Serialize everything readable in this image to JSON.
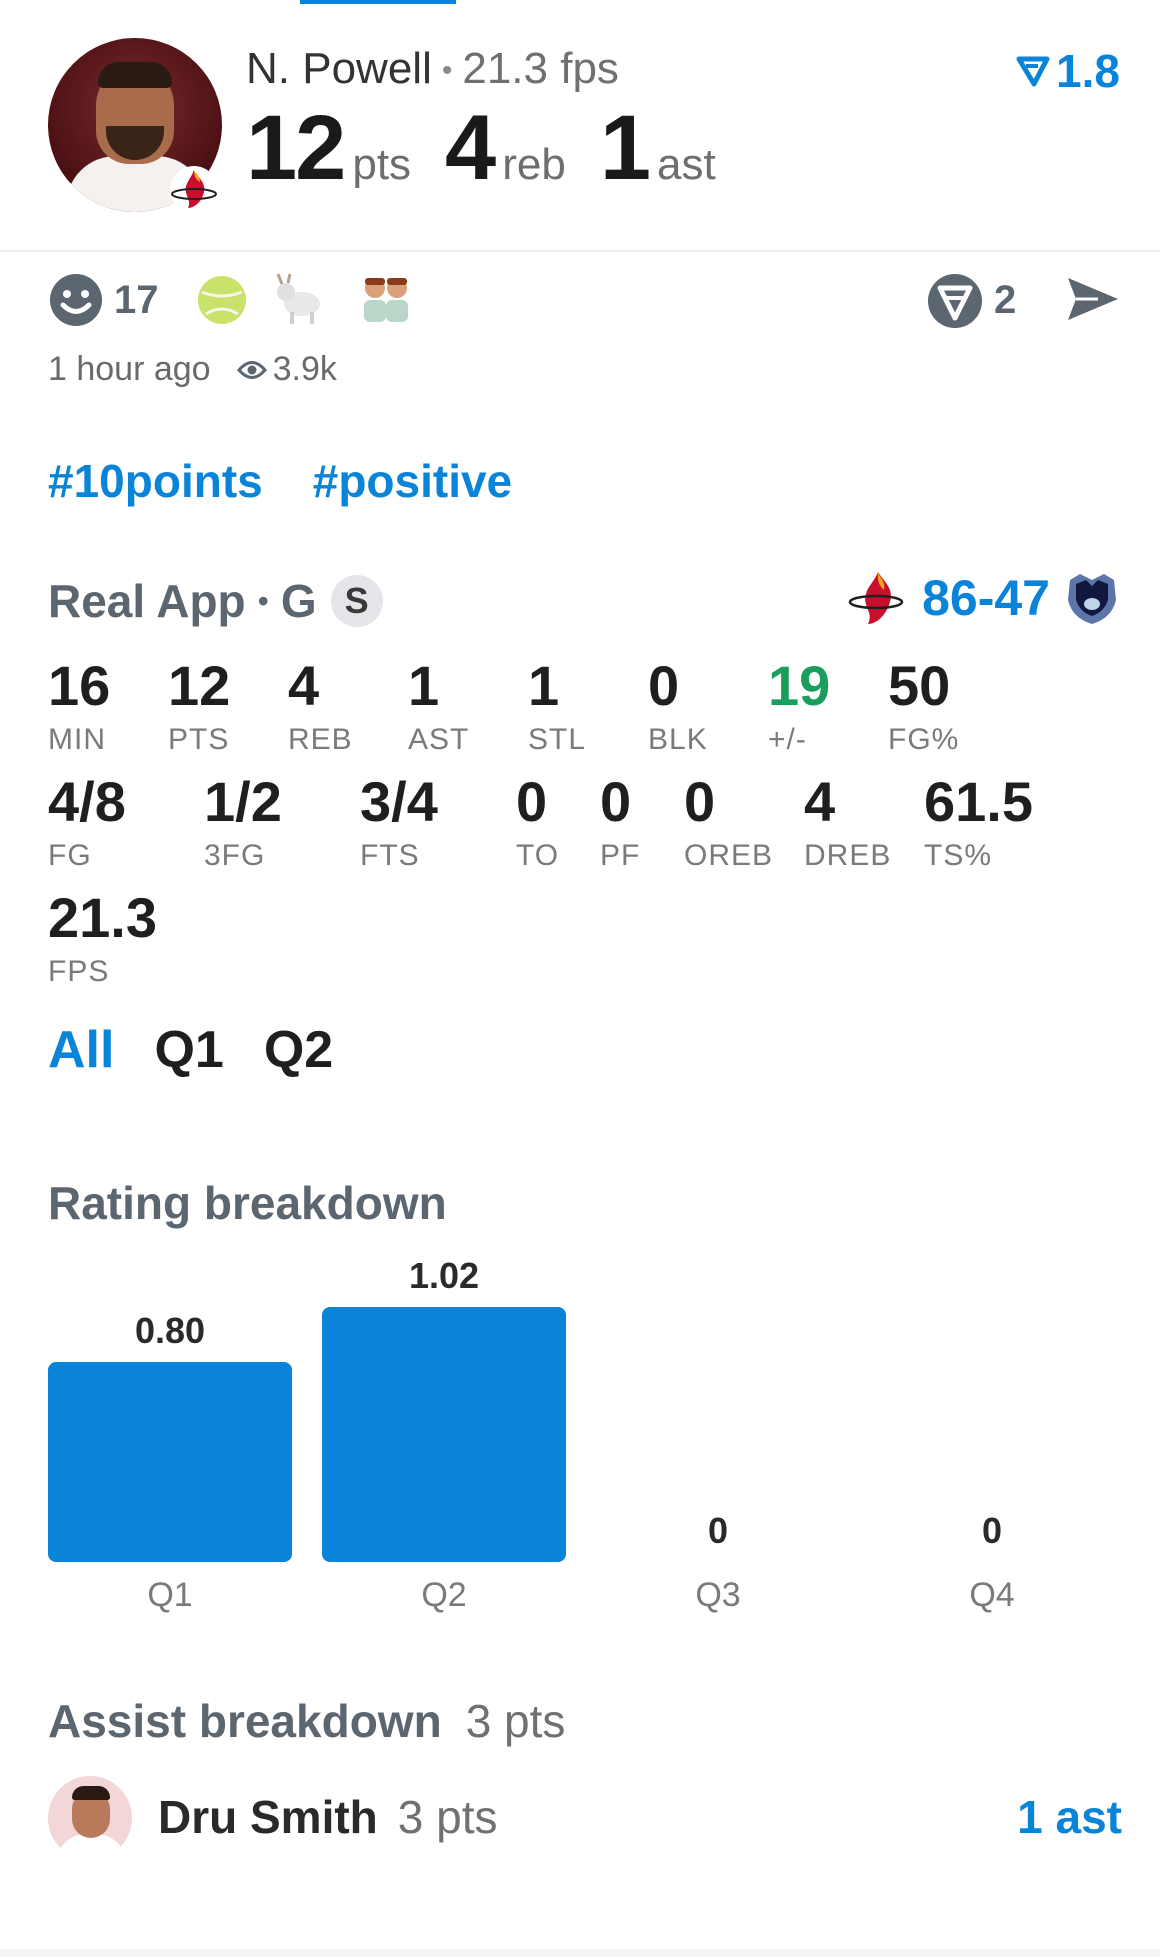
{
  "header": {
    "player_name": "N. Powell",
    "player_fps": "21.3 fps",
    "stats": [
      {
        "value": "12",
        "unit": "pts"
      },
      {
        "value": "4",
        "unit": "reb"
      },
      {
        "value": "1",
        "unit": "ast"
      }
    ],
    "rating": "1.8"
  },
  "social": {
    "reaction_count": "17",
    "emojis": [
      "tennis-ball",
      "goat",
      "twins"
    ],
    "comment_count": "2",
    "time_ago": "1 hour ago",
    "views": "3.9k"
  },
  "tags": [
    "#10points",
    "#positive"
  ],
  "game": {
    "league_label": "Real App",
    "position": "G",
    "starter_badge": "S",
    "score": "86-47"
  },
  "stats_row1": [
    {
      "value": "16",
      "label": "MIN"
    },
    {
      "value": "12",
      "label": "PTS"
    },
    {
      "value": "4",
      "label": "REB"
    },
    {
      "value": "1",
      "label": "AST"
    },
    {
      "value": "1",
      "label": "STL"
    },
    {
      "value": "0",
      "label": "BLK"
    },
    {
      "value": "19",
      "label": "+/-"
    },
    {
      "value": "50",
      "label": "FG%"
    }
  ],
  "stats_row2": [
    {
      "value": "4/8",
      "label": "FG"
    },
    {
      "value": "1/2",
      "label": "3FG"
    },
    {
      "value": "3/4",
      "label": "FTS"
    },
    {
      "value": "0",
      "label": "TO"
    },
    {
      "value": "0",
      "label": "PF"
    },
    {
      "value": "0",
      "label": "OREB"
    },
    {
      "value": "4",
      "label": "DREB"
    },
    {
      "value": "61.5",
      "label": "TS%"
    }
  ],
  "stats_row3": [
    {
      "value": "21.3",
      "label": "FPS"
    }
  ],
  "quarter_tabs": [
    "All",
    "Q1",
    "Q2"
  ],
  "rating_breakdown": {
    "title": "Rating breakdown"
  },
  "chart_data": {
    "type": "bar",
    "categories": [
      "Q1",
      "Q2",
      "Q3",
      "Q4"
    ],
    "values": [
      0.8,
      1.02,
      0,
      0
    ],
    "value_labels": [
      "0.80",
      "1.02",
      "0",
      "0"
    ],
    "color": "#0a84d8"
  },
  "assist_breakdown": {
    "title": "Assist breakdown",
    "total": "3 pts",
    "items": [
      {
        "name": "Dru Smith",
        "pts": "3 pts",
        "ast": "1 ast"
      }
    ]
  },
  "colors": {
    "accent": "#0a84d8",
    "positive": "#1a9e5c"
  }
}
